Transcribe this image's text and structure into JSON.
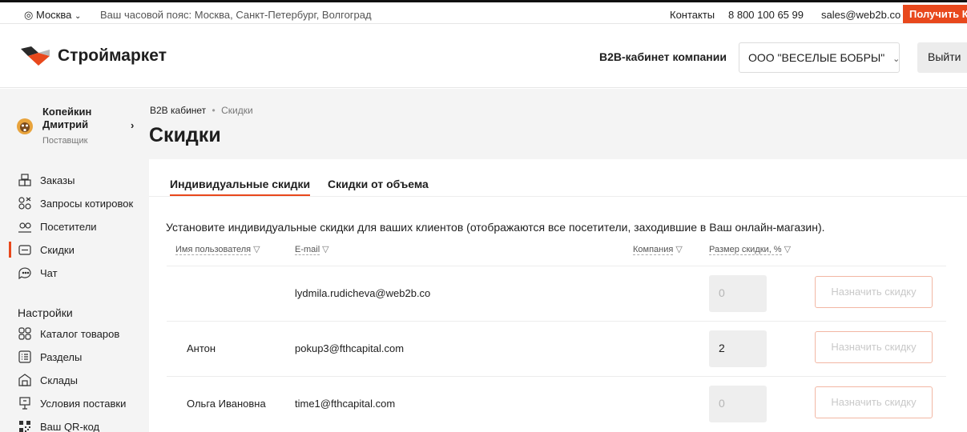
{
  "topbar": {
    "city": "Москва",
    "timezone": "Ваш часовой пояс: Москва, Санкт-Петербург, Волгоград",
    "contacts": "Контакты",
    "phone": "8 800 100 65 99",
    "email": "sales@web2b.co",
    "cta": "Получить КП"
  },
  "header": {
    "logo_text": "Строймаркет",
    "cabinet_label": "B2B-кабинет компании",
    "company": "ООО \"ВЕСЕЛЫЕ БОБРЫ\"",
    "logout": "Выйти"
  },
  "profile": {
    "name_line1": "Копейкин",
    "name_line2": "Дмитрий",
    "role": "Поставщик"
  },
  "menu": [
    {
      "label": "Заказы",
      "icon": "boxes-icon"
    },
    {
      "label": "Запросы котировок",
      "icon": "quotes-icon"
    },
    {
      "label": "Посетители",
      "icon": "visitors-icon"
    },
    {
      "label": "Скидки",
      "icon": "wallet-icon",
      "active": true
    },
    {
      "label": "Чат",
      "icon": "chat-icon"
    }
  ],
  "settings": {
    "title": "Настройки",
    "items": [
      {
        "label": "Каталог товаров",
        "icon": "catalog-icon"
      },
      {
        "label": "Разделы",
        "icon": "list-icon"
      },
      {
        "label": "Склады",
        "icon": "warehouse-icon"
      },
      {
        "label": "Условия поставки",
        "icon": "delivery-icon"
      },
      {
        "label": "Ваш QR-код",
        "icon": "qr-icon"
      }
    ]
  },
  "breadcrumb": {
    "root": "B2B кабинет",
    "current": "Скидки"
  },
  "page_title": "Скидки",
  "tabs": [
    {
      "label": "Индивидуальные скидки",
      "active": true
    },
    {
      "label": "Скидки от объема",
      "active": false
    }
  ],
  "intro": "Установите индивидуальные скидки для ваших клиентов (отображаются все посетители, заходившие в Ваш онлайн-магазин).",
  "table": {
    "columns": {
      "user": "Имя пользователя",
      "email": "E-mail",
      "company": "Компания",
      "discount": "Размер скидки, %"
    },
    "rows": [
      {
        "name": "",
        "email": "lydmila.rudicheva@web2b.co",
        "discount": "0",
        "action": "Назначить скидку"
      },
      {
        "name": "Антон",
        "email": "pokup3@fthcapital.com",
        "discount": "2",
        "action": "Назначить скидку"
      },
      {
        "name": "Ольга Ивановна",
        "email": "time1@fthcapital.com",
        "discount": "0",
        "action": "Назначить скидку"
      }
    ]
  },
  "colors": {
    "accent": "#e8481c",
    "page_bg": "#f4f4f4"
  }
}
